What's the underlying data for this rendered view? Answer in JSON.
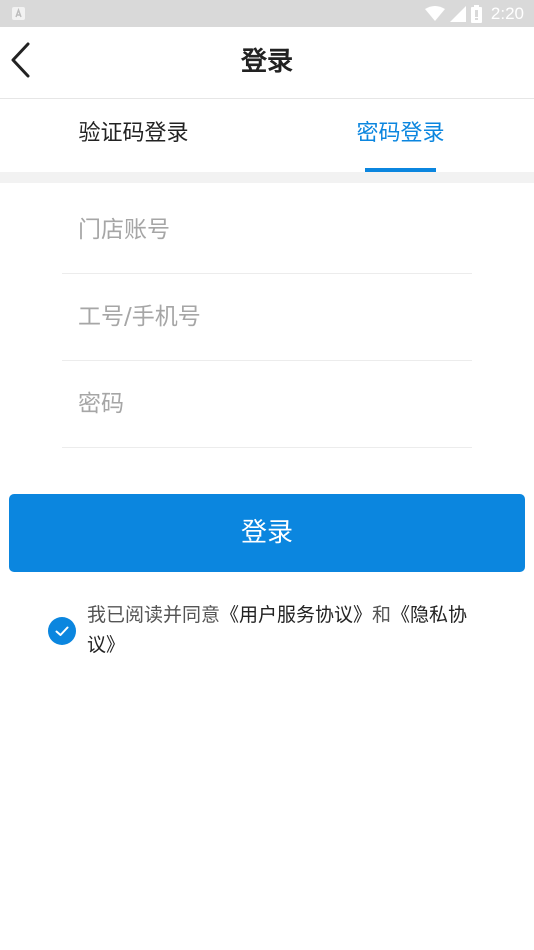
{
  "status_bar": {
    "time": "2:20",
    "icons": [
      "notification-icon",
      "wifi-icon",
      "signal-icon",
      "battery-icon"
    ]
  },
  "header": {
    "title": "登录",
    "back_icon": "chevron-left-icon"
  },
  "tabs": [
    {
      "label": "验证码登录",
      "active": false
    },
    {
      "label": "密码登录",
      "active": true
    }
  ],
  "form": {
    "store_account": {
      "placeholder": "门店账号",
      "value": ""
    },
    "staff_or_phone": {
      "placeholder": "工号/手机号",
      "value": ""
    },
    "password": {
      "placeholder": "密码",
      "value": ""
    }
  },
  "login_button": {
    "label": "登录"
  },
  "agreement": {
    "checked": true,
    "prefix": "我已阅读并同意",
    "user_agreement": "《用户服务协议》",
    "conjunction": "和",
    "privacy_policy": "《隐私协议》"
  },
  "colors": {
    "accent": "#0b86df",
    "status_bar": "#d9d9d9",
    "divider": "#f2f2f2"
  }
}
